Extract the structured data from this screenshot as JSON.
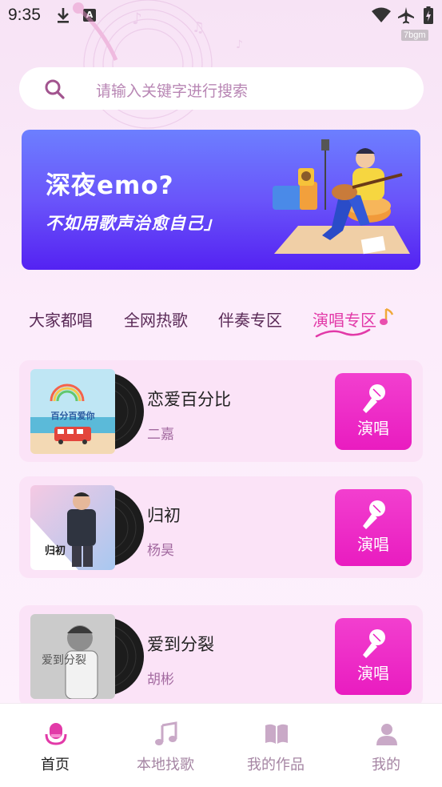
{
  "status_bar": {
    "time": "9:35",
    "app_badge": "A",
    "watermark": "7bgm"
  },
  "search": {
    "placeholder": "请输入关键字进行搜索"
  },
  "banner": {
    "title": "深夜emo?",
    "subtitle": "不如用歌声治愈自己」"
  },
  "tabs": [
    {
      "label": "大家都唱",
      "active": false
    },
    {
      "label": "全网热歌",
      "active": false
    },
    {
      "label": "伴奏专区",
      "active": false
    },
    {
      "label": "演唱专区",
      "active": true
    }
  ],
  "songs": [
    {
      "title": "恋爱百分比",
      "artist": "二嘉",
      "button_label": "演唱",
      "cover_text": "百分百爱你"
    },
    {
      "title": "归初",
      "artist": "杨昊",
      "button_label": "演唱",
      "cover_text": "归初"
    },
    {
      "title": "爱到分裂",
      "artist": "胡彬",
      "button_label": "演唱",
      "cover_text": "爱到分裂"
    }
  ],
  "bottom_nav": [
    {
      "label": "首页",
      "icon": "mic-icon",
      "active": true
    },
    {
      "label": "本地找歌",
      "icon": "music-note-icon",
      "active": false
    },
    {
      "label": "我的作品",
      "icon": "book-icon",
      "active": false
    },
    {
      "label": "我的",
      "icon": "user-icon",
      "active": false
    }
  ],
  "colors": {
    "accent": "#e91cc0",
    "active_tab": "#e23aa8",
    "artist": "#a36aa0",
    "banner_top": "#6c7fff",
    "banner_bottom": "#5422f2"
  }
}
